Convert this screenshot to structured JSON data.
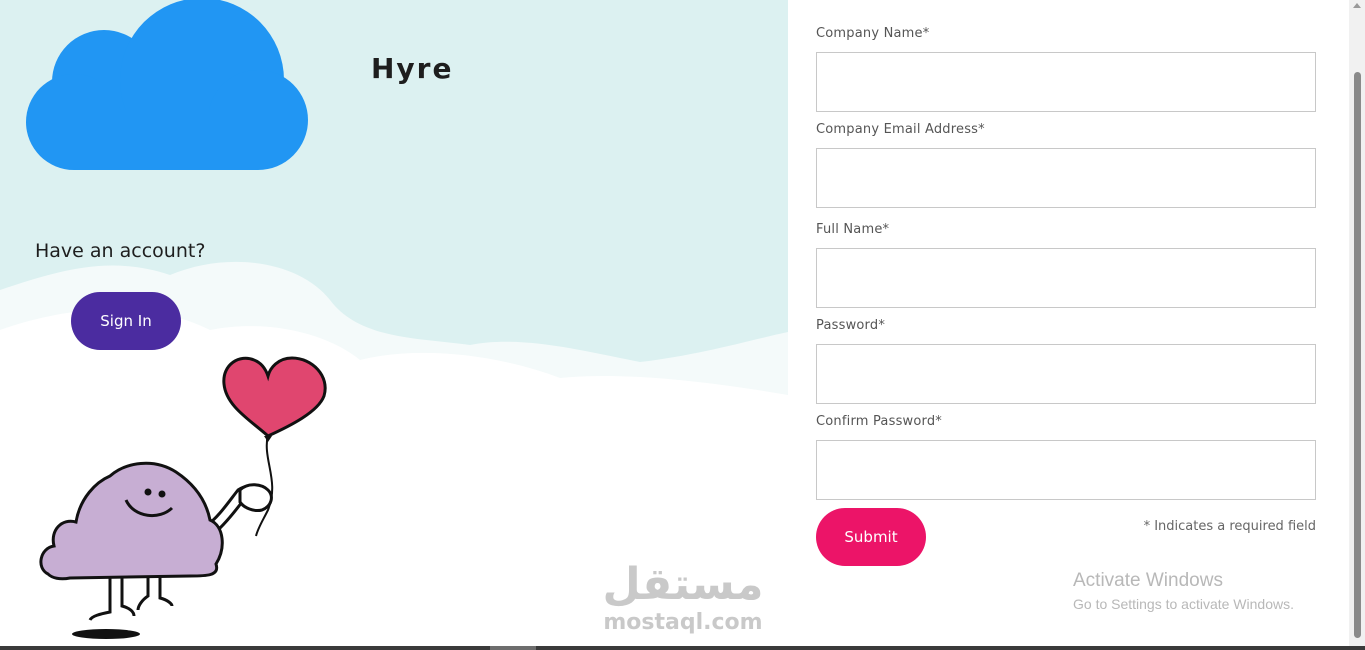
{
  "brand": {
    "name": "Hyre"
  },
  "account": {
    "prompt": "Have an account?",
    "signin_label": "Sign In"
  },
  "form": {
    "fields": [
      {
        "label": "Company Name*",
        "value": ""
      },
      {
        "label": "Company Email Address*",
        "value": ""
      },
      {
        "label": "Full Name*",
        "value": ""
      },
      {
        "label": "Password*",
        "value": ""
      },
      {
        "label": "Confirm Password*",
        "value": ""
      }
    ],
    "submit_label": "Submit",
    "required_note": "* Indicates a required field"
  },
  "watermark": {
    "arabic": "مستقل",
    "latin": "mostaql.com"
  },
  "windows_notice": {
    "title": "Activate Windows",
    "subtitle": "Go to Settings to activate Windows."
  },
  "colors": {
    "sky": "#dcf1f1",
    "logo_cloud": "#2196f3",
    "signin_button": "#4b2ca0",
    "submit_button": "#ec1468",
    "heart": "#e0466f",
    "mascot": "#c7aed3"
  },
  "icons": [
    "cloud-logo-icon",
    "heart-balloon-icon",
    "cloud-mascot-icon"
  ]
}
